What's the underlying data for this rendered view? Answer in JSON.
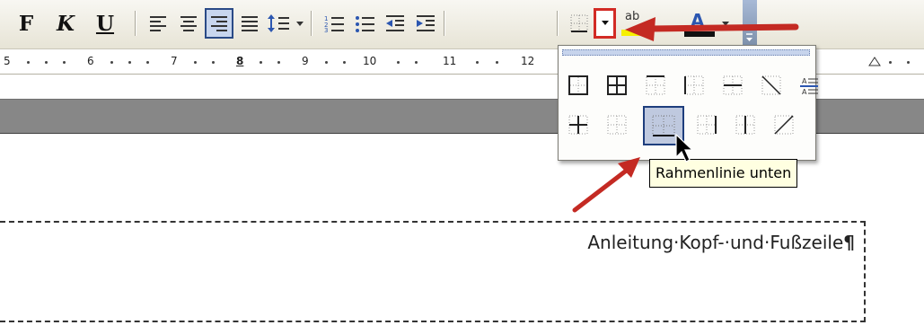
{
  "toolbar": {
    "bold_label": "F",
    "italic_label": "K",
    "underline_label": "U",
    "align_left": "align-left-icon",
    "align_center": "align-center-icon",
    "align_right": "align-right-icon",
    "justify": "justify-icon",
    "line_spacing": "line-spacing-icon",
    "numbering": "numbered-list-icon",
    "bullets": "bulleted-list-icon",
    "decrease_indent": "decrease-indent-icon",
    "increase_indent": "increase-indent-icon",
    "borders": "borders-icon",
    "highlight_label": "ab",
    "font_color_label": "A"
  },
  "ruler": {
    "numbers": [
      "5",
      "6",
      "7",
      "8",
      "9",
      "10",
      "11",
      "12"
    ]
  },
  "borders_palette": {
    "selected": "Rahmenlinie unten",
    "rows": [
      [
        "outside-borders-icon",
        "all-borders-icon",
        "top-border-icon",
        "left-border-icon",
        "inside-horizontal-border-icon",
        "diagonal-down-border-icon",
        "horizontal-line-icon"
      ],
      [
        "inside-borders-icon",
        "no-border-icon",
        "bottom-border-icon",
        "right-border-icon",
        "inside-vertical-border-icon",
        "diagonal-up-border-icon"
      ]
    ]
  },
  "tooltip": {
    "text": "Rahmenlinie unten"
  },
  "document": {
    "header_text": "Anleitung·Kopf-·und·Fußzeile",
    "pilcrow": "¶"
  },
  "colors": {
    "annotation_arrow": "#c42a23",
    "selection_blue": "#1e3e7d",
    "highlight_yellow": "#f6f000"
  }
}
